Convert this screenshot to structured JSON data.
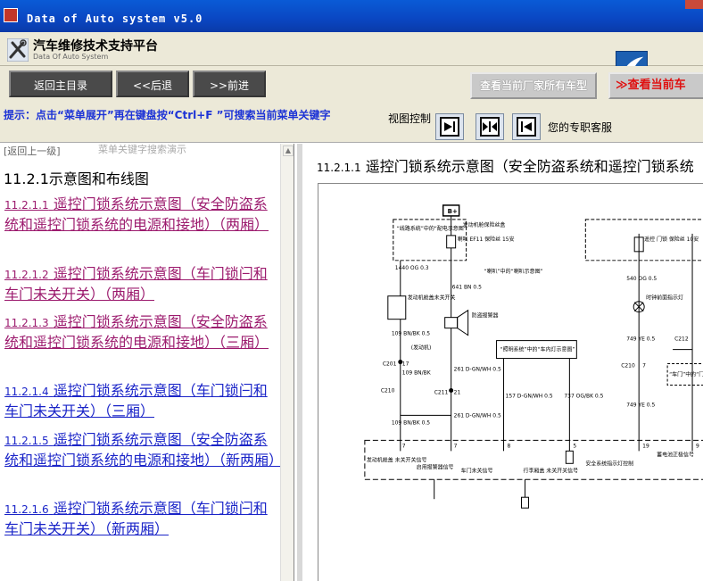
{
  "window": {
    "title": "Data of Auto system v5.0"
  },
  "app": {
    "title": "汽车维修技术支持平台",
    "subtitle": "Data Of Auto System"
  },
  "nav": {
    "home": "返回主目录",
    "back": "<<后退",
    "forward": ">>前进",
    "all_models": "查看当前厂家所有车型",
    "current_model": "≫查看当前车"
  },
  "toolbar": {
    "hint": "提示：点击“菜单展开”再在键盘按“Ctrl+F ”可搜索当前菜单关键字",
    "view_control": "视图控制",
    "support": "您的专职客服"
  },
  "left": {
    "back_link": "[返回上一级]",
    "ghost_text": "菜单关键字搜索演示",
    "section_title": "11.2.1示意图和布线图",
    "entries": [
      {
        "num": "11.2.1.1",
        "title": "遥控门锁系统示意图（安全防盗系统和遥控门锁系统的电源和接地）（两厢）"
      },
      {
        "num": "11.2.1.2",
        "title": "遥控门锁系统示意图（车门锁闩和车门未关开关）（两厢）"
      },
      {
        "num": "11.2.1.3",
        "title": "遥控门锁系统示意图（安全防盗系统和遥控门锁系统的电源和接地）（三厢）"
      },
      {
        "num": "11.2.1.4",
        "title": "遥控门锁系统示意图（车门锁闩和车门未关开关）（三厢）"
      },
      {
        "num": "11.2.1.5",
        "title": "遥控门锁系统示意图（安全防盗系统和遥控门锁系统的电源和接地）（新两厢）"
      },
      {
        "num": "11.2.1.6",
        "title": "遥控门锁系统示意图（车门锁闩和车门未关开关）（新两厢）"
      }
    ]
  },
  "figure": {
    "num": "11.2.1.1",
    "title": "遥控门锁系统示意图（安全防盗系统和遥控门锁系统",
    "labels": {
      "b_plus": "B+",
      "fuse_box": "发动机舱保险丝盒",
      "power_dist": "“线路系统”中的“配电示意图”",
      "fuse": "喇叭 EF11 保险丝 15安",
      "w1440": "1440 OG 0.3",
      "w641": "641 BN 0.5",
      "horn_ref": "“喇叭”中的“喇叭示意图”",
      "hood_switch": "发动机舱盖未关开关",
      "alarm": "防盗报警器",
      "w109a": "109 BN/BK 0.5",
      "hatch": "(发动机)",
      "c201": "C201",
      "c210": "C210",
      "c211": "C211",
      "w109b": "109 BN/BK",
      "w261a": "261 D-GN/WH 0.5",
      "w261b": "261 D-GN/WH 0.5",
      "w109c": "109 BN/BK 0.5",
      "lighting_ref": "“照明系统”中的“车内灯示意图”",
      "w157": "157 D-GN/WH 0.5",
      "w737": "737 OG/BK 0.5",
      "relay_drive": "启用报警器信号",
      "module_label": "发动机舱盖 未关开关信号",
      "door_open": "车门未关信号",
      "trunk_switch": "行李厢盖 未关开关信号",
      "security_led": "安全系统指示灯控制",
      "battery": "蓄电池正极信号",
      "rke_fuse": "遥控 门锁 保险丝 10安",
      "w540": "540 OG 0.5",
      "lamp_ref": "时钟前面指示灯",
      "w749a": "749 YE 0.5",
      "c212": "C212",
      "door_ref": "“车门”中的“门锁指示器示意图”",
      "w749b": "749 YE 0.5",
      "pin8": "8",
      "pin5": "5",
      "pin19": "19",
      "pin9": "9",
      "pin17": "17",
      "pin21": "21",
      "pin7": "7",
      "pin7b": "7",
      "pin7c": "7"
    }
  }
}
